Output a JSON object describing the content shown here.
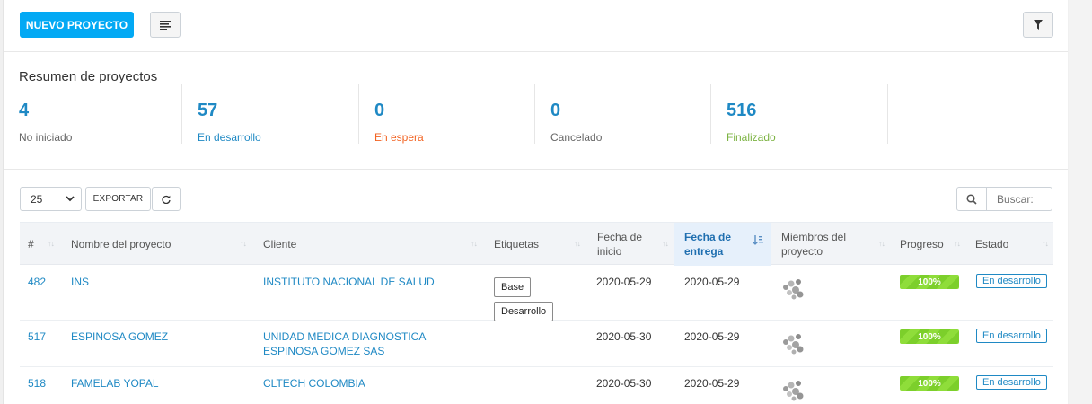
{
  "toolbar": {
    "new_project_label": "NUEVO PROYECTO",
    "list_icon": "list-icon",
    "filter_icon": "filter-icon"
  },
  "summary": {
    "title": "Resumen de proyectos",
    "stats": [
      {
        "value": "4",
        "label": "No iniciado",
        "label_color": "#666666"
      },
      {
        "value": "57",
        "label": "En desarrollo",
        "label_color": "#1f89c4"
      },
      {
        "value": "0",
        "label": "En espera",
        "label_color": "#f26322"
      },
      {
        "value": "0",
        "label": "Cancelado",
        "label_color": "#666666"
      },
      {
        "value": "516",
        "label": "Finalizado",
        "label_color": "#7cb342"
      }
    ]
  },
  "table_controls": {
    "page_size": "25",
    "export_label": "EXPORTAR",
    "search_placeholder": "Buscar:"
  },
  "table": {
    "columns": [
      "#",
      "Nombre del proyecto",
      "Cliente",
      "Etiquetas",
      "Fecha de inicio",
      "Fecha de entrega",
      "Miembros del proyecto",
      "Progreso",
      "Estado"
    ],
    "rows": [
      {
        "id": "482",
        "name": "INS",
        "client": "INSTITUTO NACIONAL DE SALUD",
        "tags": [
          "Base",
          "Desarrollo"
        ],
        "start": "2020-05-29",
        "due": "2020-05-29",
        "progress": "100%",
        "status": "En desarrollo"
      },
      {
        "id": "517",
        "name": "ESPINOSA GOMEZ",
        "client": "UNIDAD MEDICA DIAGNOSTICA ESPINOSA GOMEZ SAS",
        "tags": [],
        "start": "2020-05-30",
        "due": "2020-05-29",
        "progress": "100%",
        "status": "En desarrollo"
      },
      {
        "id": "518",
        "name": "FAMELAB YOPAL",
        "client": "CLTECH COLOMBIA",
        "tags": [],
        "start": "2020-05-30",
        "due": "2020-05-29",
        "progress": "100%",
        "status": "En desarrollo"
      }
    ]
  },
  "colors": {
    "accent": "#03a9f4",
    "link": "#1f89c4",
    "progress": "#7ccf2b"
  }
}
